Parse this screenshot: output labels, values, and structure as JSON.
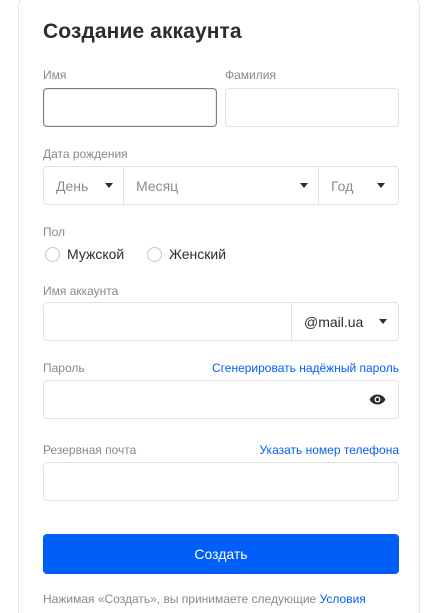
{
  "form": {
    "title": "Создание аккаунта",
    "first_name": {
      "label": "Имя",
      "value": ""
    },
    "last_name": {
      "label": "Фамилия",
      "value": ""
    },
    "birthdate": {
      "label": "Дата рождения",
      "day_placeholder": "День",
      "month_placeholder": "Месяц",
      "year_placeholder": "Год"
    },
    "gender": {
      "label": "Пол",
      "options": [
        "Мужской",
        "Женский"
      ]
    },
    "account": {
      "label": "Имя аккаунта",
      "value": "",
      "domain": "@mail.ua"
    },
    "password": {
      "label": "Пароль",
      "generate_link": "Сгенерировать надёжный пароль",
      "icon": "eye-icon"
    },
    "backup_email": {
      "label": "Резервная почта",
      "phone_link": "Указать номер телефона"
    },
    "submit_label": "Создать",
    "terms_text": "Нажимая «Создать», вы принимаете следующие ",
    "terms_link": "Условия"
  },
  "colors": {
    "accent": "#005ff9",
    "label": "#87898f",
    "border": "#e1e2e6",
    "text": "#2c2d2e"
  }
}
